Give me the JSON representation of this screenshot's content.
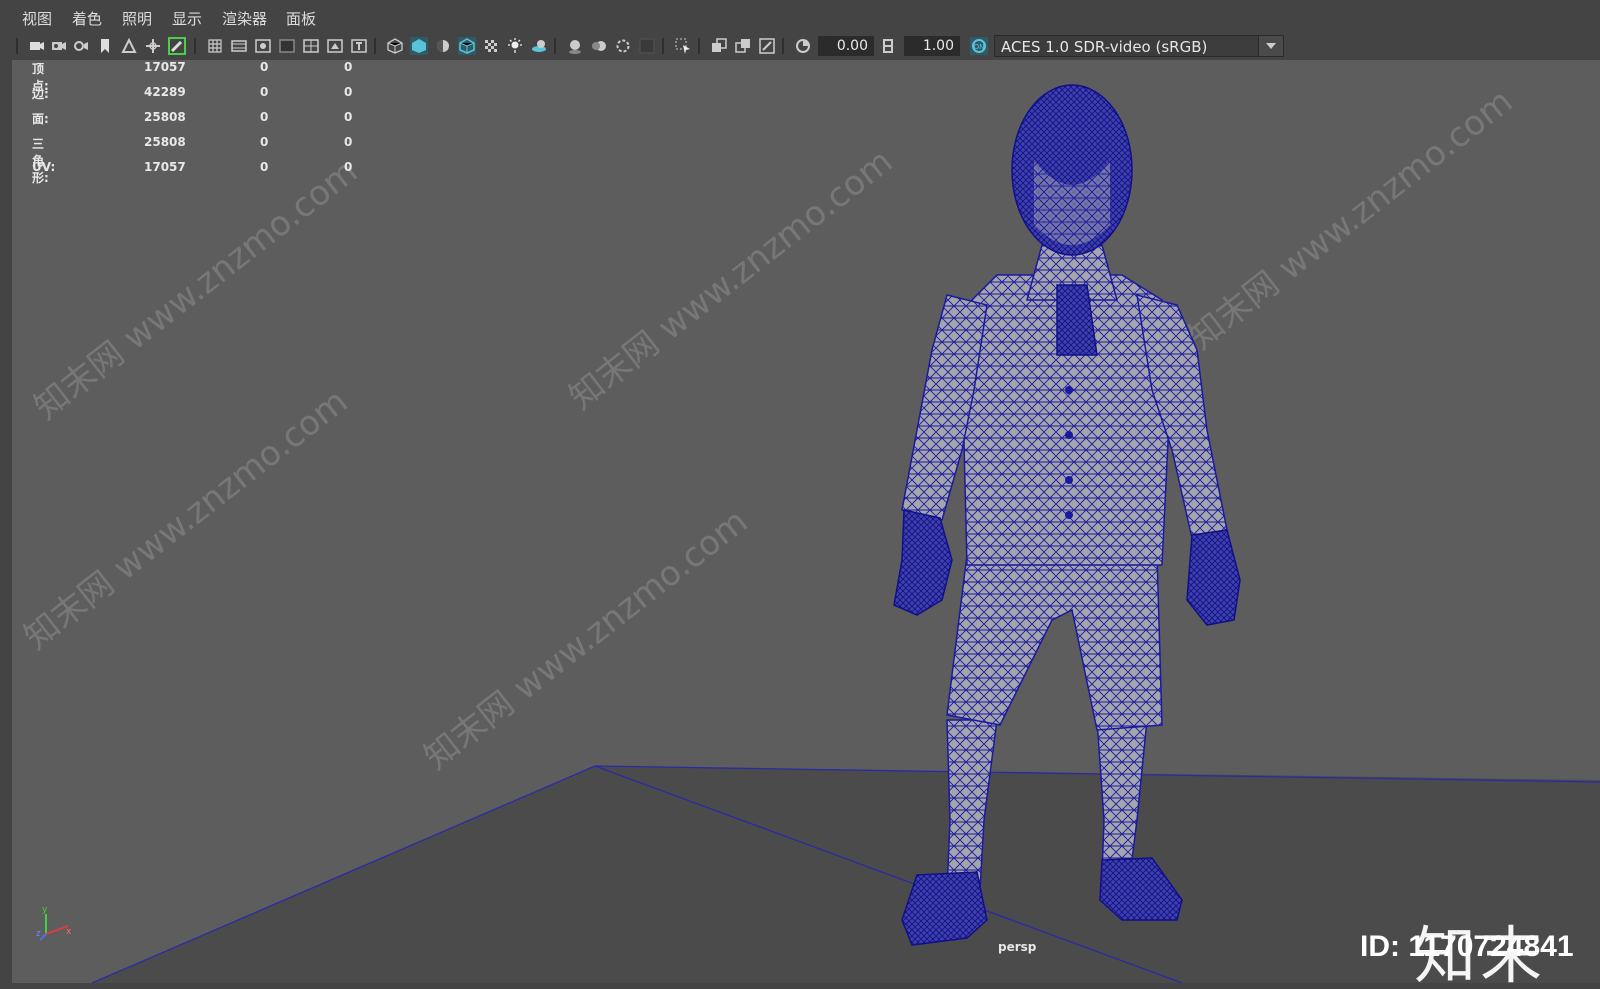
{
  "menubar": {
    "items": [
      "视图",
      "着色",
      "照明",
      "显示",
      "渲染器",
      "面板"
    ]
  },
  "toolbar": {
    "exposure_value": "0.00",
    "gamma_value": "1.00",
    "color_space": "ACES 1.0 SDR-video (sRGB)",
    "highlight_color": "#59c4d9",
    "accent_green": "#4bcf4b"
  },
  "heads_up_display": {
    "rows": [
      {
        "label": "顶点:",
        "value": "17057",
        "selected": "0",
        "other": "0"
      },
      {
        "label": "边:",
        "value": "42289",
        "selected": "0",
        "other": "0"
      },
      {
        "label": "面:",
        "value": "25808",
        "selected": "0",
        "other": "0"
      },
      {
        "label": "三角形:",
        "value": "25808",
        "selected": "0",
        "other": "0"
      },
      {
        "label": "UV:",
        "value": "17057",
        "selected": "0",
        "other": "0"
      }
    ]
  },
  "viewport": {
    "camera_label": "persp",
    "background_color": "#5d5d5d",
    "ground_color": "#4b4b4b",
    "wireframe_color": "#1a1aa0",
    "axis_labels": {
      "y": "y",
      "z": "z",
      "x": "x"
    }
  },
  "watermark": {
    "text": "知末网 www.znzmo.com"
  },
  "brand": {
    "logo_text": "知末",
    "id_text": "ID: 1170724841"
  }
}
